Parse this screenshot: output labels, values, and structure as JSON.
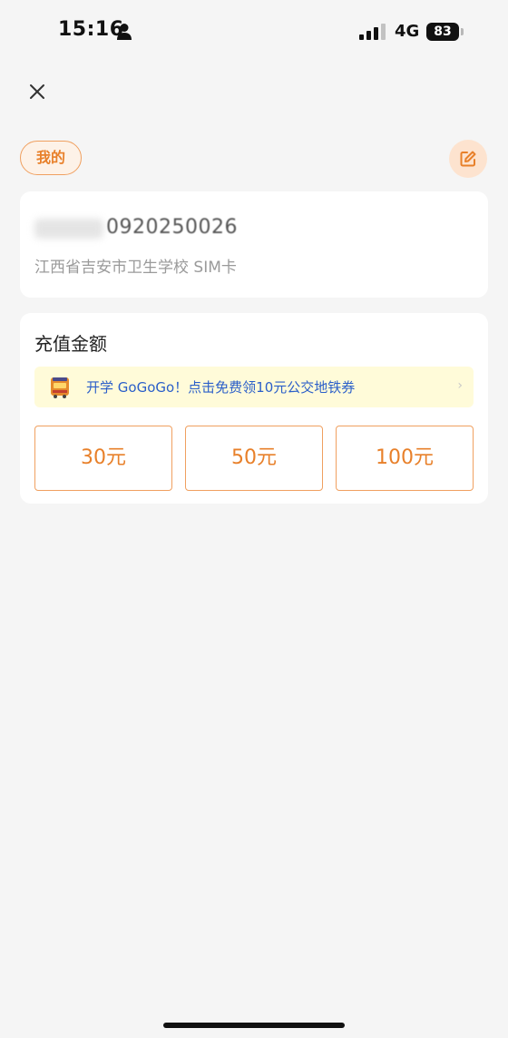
{
  "status_bar": {
    "time": "15:16",
    "network": "4G",
    "battery": "83"
  },
  "header": {
    "mine_label": "我的"
  },
  "account": {
    "number": "0920250026",
    "description": "江西省吉安市卫生学校 SIM卡"
  },
  "recharge": {
    "title": "充值金额",
    "promo_text": "开学 GoGoGo！点击免费领10元公交地铁券",
    "amounts": [
      {
        "label": "30元"
      },
      {
        "label": "50元"
      },
      {
        "label": "100元"
      }
    ]
  },
  "icons": {
    "close": "close-icon",
    "edit": "edit-icon",
    "promo": "bus-ticket-icon",
    "person": "person-icon",
    "signal": "signal-icon"
  },
  "colors": {
    "accent": "#e8802a",
    "accent_border": "#f0a060",
    "promo_bg": "#fffbd9",
    "promo_text": "#2b5fc9",
    "page_bg": "#f5f5f5"
  }
}
